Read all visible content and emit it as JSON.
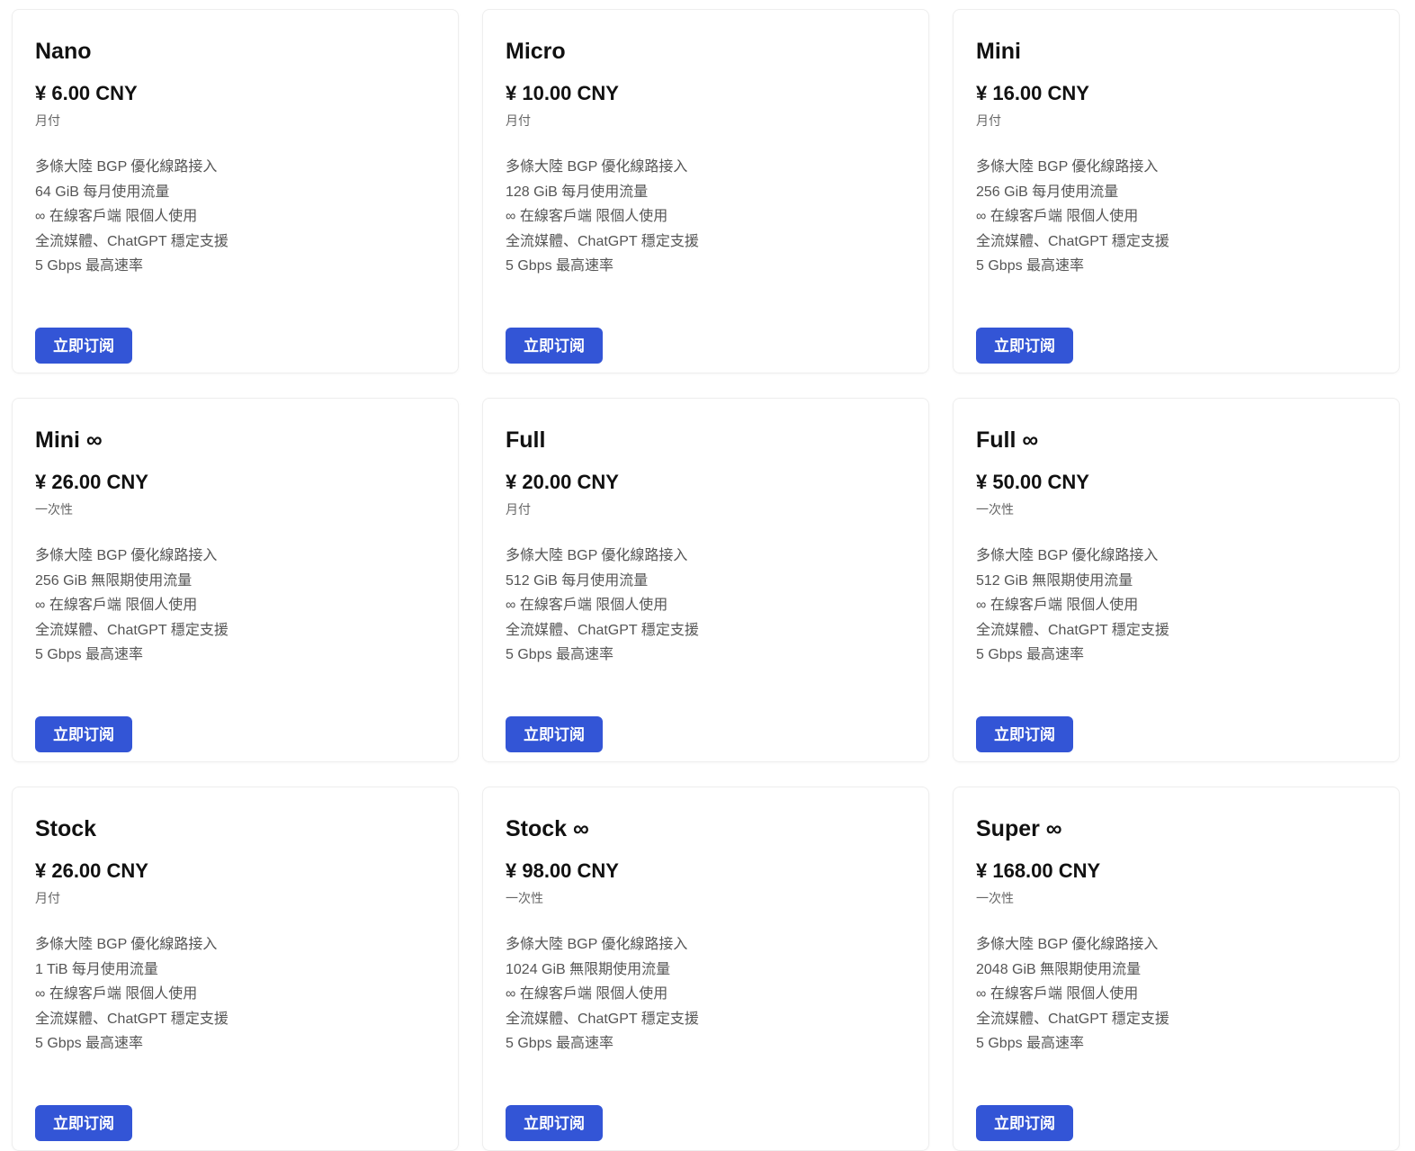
{
  "accent_color": "#3355d6",
  "subscribe_label": "立即订阅",
  "plans": [
    {
      "name": "Nano",
      "price": "¥ 6.00 CNY",
      "period": "月付",
      "features": [
        "多條大陸 BGP 優化線路接入",
        "64 GiB 每月使用流量",
        "∞ 在線客戶端 限個人使用",
        "全流媒體、ChatGPT 穩定支援",
        "5 Gbps 最高速率"
      ]
    },
    {
      "name": "Micro",
      "price": "¥ 10.00 CNY",
      "period": "月付",
      "features": [
        "多條大陸 BGP 優化線路接入",
        "128 GiB 每月使用流量",
        "∞ 在線客戶端 限個人使用",
        "全流媒體、ChatGPT 穩定支援",
        "5 Gbps 最高速率"
      ]
    },
    {
      "name": "Mini",
      "price": "¥ 16.00 CNY",
      "period": "月付",
      "features": [
        "多條大陸 BGP 優化線路接入",
        "256 GiB 每月使用流量",
        "∞ 在線客戶端 限個人使用",
        "全流媒體、ChatGPT 穩定支援",
        "5 Gbps 最高速率"
      ]
    },
    {
      "name": "Mini ∞",
      "price": "¥ 26.00 CNY",
      "period": "一次性",
      "features": [
        "多條大陸 BGP 優化線路接入",
        "256 GiB 無限期使用流量",
        "∞ 在線客戶端 限個人使用",
        "全流媒體、ChatGPT 穩定支援",
        "5 Gbps 最高速率"
      ]
    },
    {
      "name": "Full",
      "price": "¥ 20.00 CNY",
      "period": "月付",
      "features": [
        "多條大陸 BGP 優化線路接入",
        "512 GiB 每月使用流量",
        "∞ 在線客戶端 限個人使用",
        "全流媒體、ChatGPT 穩定支援",
        "5 Gbps 最高速率"
      ]
    },
    {
      "name": "Full ∞",
      "price": "¥ 50.00 CNY",
      "period": "一次性",
      "features": [
        "多條大陸 BGP 優化線路接入",
        "512 GiB 無限期使用流量",
        "∞ 在線客戶端 限個人使用",
        "全流媒體、ChatGPT 穩定支援",
        "5 Gbps 最高速率"
      ]
    },
    {
      "name": "Stock",
      "price": "¥ 26.00 CNY",
      "period": "月付",
      "features": [
        "多條大陸 BGP 優化線路接入",
        "1 TiB 每月使用流量",
        "∞ 在線客戶端 限個人使用",
        "全流媒體、ChatGPT 穩定支援",
        "5 Gbps 最高速率"
      ]
    },
    {
      "name": "Stock ∞",
      "price": "¥ 98.00 CNY",
      "period": "一次性",
      "features": [
        "多條大陸 BGP 優化線路接入",
        "1024 GiB 無限期使用流量",
        "∞ 在線客戶端 限個人使用",
        "全流媒體、ChatGPT 穩定支援",
        "5 Gbps 最高速率"
      ]
    },
    {
      "name": "Super ∞",
      "price": "¥ 168.00 CNY",
      "period": "一次性",
      "features": [
        "多條大陸 BGP 優化線路接入",
        "2048 GiB 無限期使用流量",
        "∞ 在線客戶端 限個人使用",
        "全流媒體、ChatGPT 穩定支援",
        "5 Gbps 最高速率"
      ]
    }
  ]
}
